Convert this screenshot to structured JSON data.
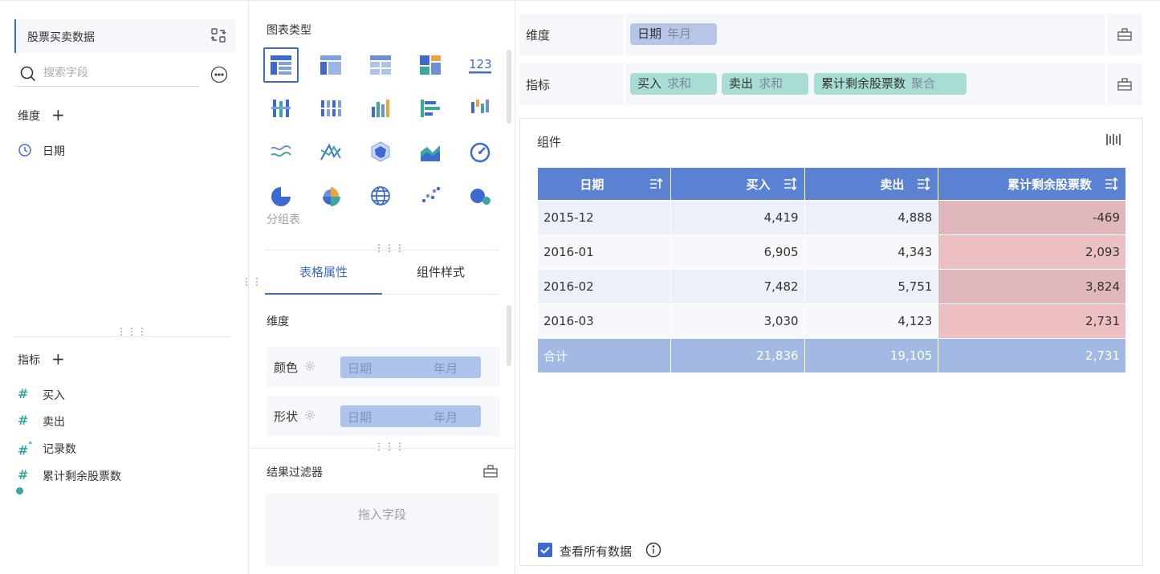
{
  "left": {
    "dataset_title": "股票买卖数据",
    "search_placeholder": "搜索字段",
    "dimensions_label": "维度",
    "dimensions": [
      {
        "label": "日期",
        "icon": "clock-icon"
      }
    ],
    "measures_label": "指标",
    "measures": [
      {
        "label": "买入",
        "icon": "hash-icon"
      },
      {
        "label": "卖出",
        "icon": "hash-icon"
      },
      {
        "label": "记录数",
        "icon": "hash-star-icon"
      },
      {
        "label": "累计剩余股票数",
        "icon": "hash-calc-icon"
      }
    ]
  },
  "middle": {
    "chart_type_title": "图表类型",
    "selected_chart_caption": "分组表",
    "tabs": [
      {
        "label": "表格属性",
        "active": true
      },
      {
        "label": "组件样式",
        "active": false
      }
    ],
    "props_title": "维度",
    "props": [
      {
        "label": "颜色",
        "field": "日期",
        "granularity": "年月"
      },
      {
        "label": "形状",
        "field": "日期",
        "granularity": "年月"
      }
    ],
    "filter_title": "结果过滤器",
    "dropzone_text": "拖入字段"
  },
  "shelves": {
    "dimension": {
      "label": "维度",
      "chips": [
        {
          "name": "日期",
          "agg": "年月"
        }
      ]
    },
    "measure": {
      "label": "指标",
      "chips": [
        {
          "name": "买入",
          "agg": "求和"
        },
        {
          "name": "卖出",
          "agg": "求和"
        },
        {
          "name": "累计剩余股票数",
          "agg": "聚合"
        }
      ]
    }
  },
  "widget": {
    "title": "组件",
    "columns": [
      "日期",
      "买入",
      "卖出",
      "累计剩余股票数"
    ],
    "rows": [
      [
        "2015-12",
        "4,419",
        "4,888",
        "-469"
      ],
      [
        "2016-01",
        "6,905",
        "4,343",
        "2,093"
      ],
      [
        "2016-02",
        "7,482",
        "5,751",
        "3,824"
      ],
      [
        "2016-03",
        "3,030",
        "4,123",
        "2,731"
      ]
    ],
    "total": [
      "合计",
      "21,836",
      "19,105",
      "2,731"
    ],
    "view_all_label": "查看所有数据"
  },
  "colors": {
    "accent": "#3d6ad1",
    "header": "#5b81d2",
    "total_row": "#a2b9e3",
    "highlight": "#e9b9bd",
    "dim_chip": "#b7c6e8",
    "measure_chip": "#a8ddd6"
  }
}
